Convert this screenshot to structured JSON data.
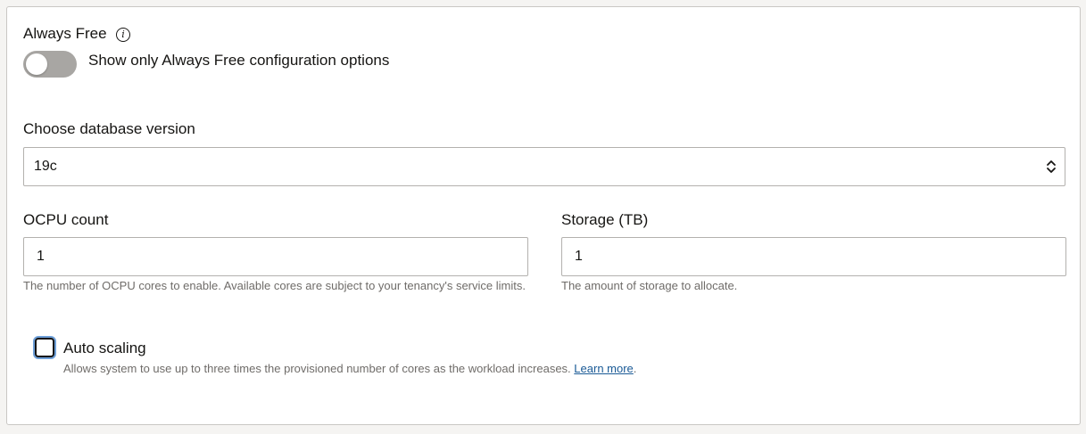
{
  "always_free": {
    "label": "Always Free",
    "info_icon_glyph": "i",
    "toggle_on": false,
    "toggle_label": "Show only Always Free configuration options"
  },
  "database_version": {
    "label": "Choose database version",
    "selected": "19c"
  },
  "ocpu": {
    "label": "OCPU count",
    "value": "1",
    "help": "The number of OCPU cores to enable. Available cores are subject to your tenancy's service limits."
  },
  "storage": {
    "label": "Storage (TB)",
    "value": "1",
    "help": "The amount of storage to allocate."
  },
  "auto_scaling": {
    "label": "Auto scaling",
    "checked": false,
    "help": "Allows system to use up to three times the provisioned number of cores as the workload increases.",
    "link": "Learn more",
    "trailing": "."
  },
  "colors": {
    "toggle_off": "#a8a6a3",
    "link": "#1a5a96",
    "focus_ring": "#6e9fd8"
  }
}
